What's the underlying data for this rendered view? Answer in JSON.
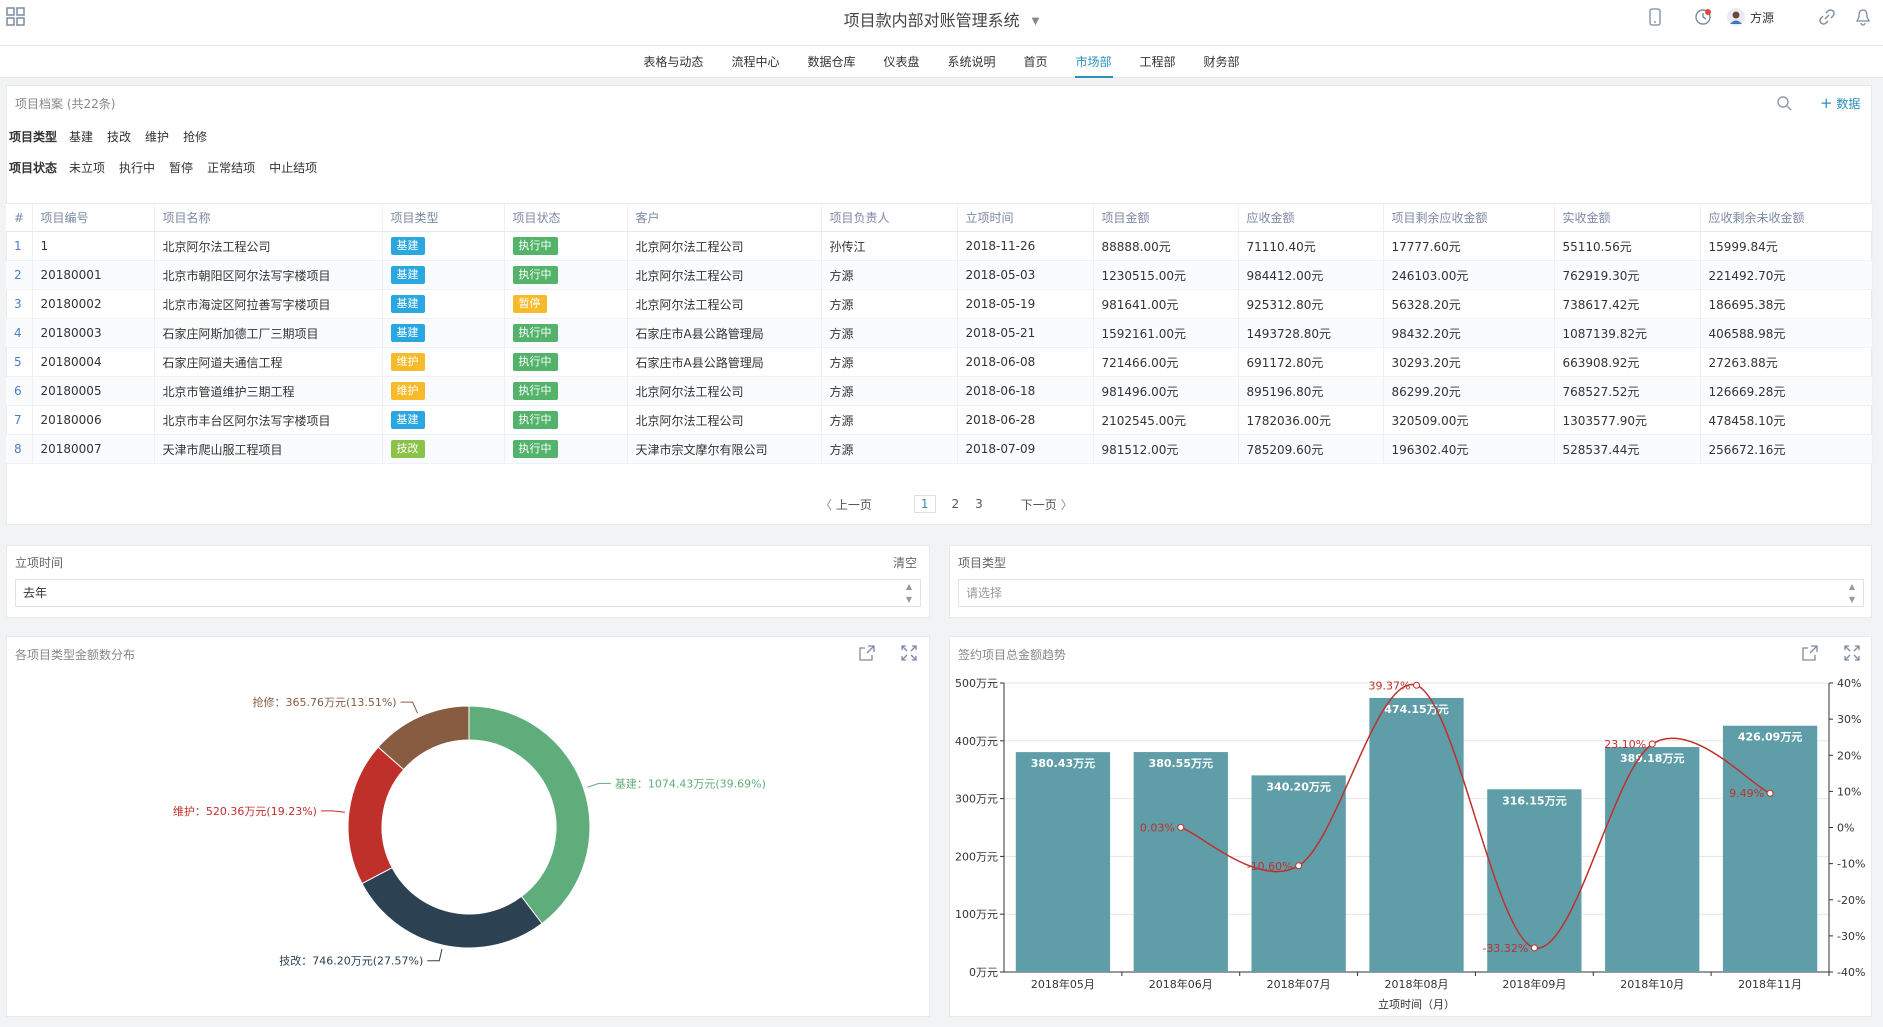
{
  "header": {
    "title": "项目款内部对账管理系统",
    "user_name": "方源"
  },
  "nav": {
    "tabs": [
      "表格与动态",
      "流程中心",
      "数据仓库",
      "仪表盘",
      "系统说明",
      "首页",
      "市场部",
      "工程部",
      "财务部"
    ],
    "active_index": 6
  },
  "archive": {
    "title": "项目档案 (共22条)",
    "add_label": "数据",
    "filters": [
      {
        "label": "项目类型",
        "options": [
          "基建",
          "技改",
          "维护",
          "抢修"
        ]
      },
      {
        "label": "项目状态",
        "options": [
          "未立项",
          "执行中",
          "暂停",
          "正常结项",
          "中止结项"
        ]
      }
    ],
    "columns": [
      "#",
      "项目编号",
      "项目名称",
      "项目类型",
      "项目状态",
      "客户",
      "项目负责人",
      "立项时间",
      "项目金额",
      "应收金额",
      "项目剩余应收金额",
      "实收金额",
      "应收剩余未收金额"
    ],
    "rows": [
      [
        "1",
        "1",
        "北京阿尔法工程公司",
        "基建",
        "执行中",
        "北京阿尔法工程公司",
        "孙传江",
        "2018-11-26",
        "88888.00元",
        "71110.40元",
        "17777.60元",
        "55110.56元",
        "15999.84元"
      ],
      [
        "2",
        "20180001",
        "北京市朝阳区阿尔法写字楼项目",
        "基建",
        "执行中",
        "北京阿尔法工程公司",
        "方源",
        "2018-05-03",
        "1230515.00元",
        "984412.00元",
        "246103.00元",
        "762919.30元",
        "221492.70元"
      ],
      [
        "3",
        "20180002",
        "北京市海淀区阿拉善写字楼项目",
        "基建",
        "暂停",
        "北京阿尔法工程公司",
        "方源",
        "2018-05-19",
        "981641.00元",
        "925312.80元",
        "56328.20元",
        "738617.42元",
        "186695.38元"
      ],
      [
        "4",
        "20180003",
        "石家庄阿斯加德工厂三期项目",
        "基建",
        "执行中",
        "石家庄市A县公路管理局",
        "方源",
        "2018-05-21",
        "1592161.00元",
        "1493728.80元",
        "98432.20元",
        "1087139.82元",
        "406588.98元"
      ],
      [
        "5",
        "20180004",
        "石家庄阿道夫通信工程",
        "维护",
        "执行中",
        "石家庄市A县公路管理局",
        "方源",
        "2018-06-08",
        "721466.00元",
        "691172.80元",
        "30293.20元",
        "663908.92元",
        "27263.88元"
      ],
      [
        "6",
        "20180005",
        "北京市管道维护三期工程",
        "维护",
        "执行中",
        "北京阿尔法工程公司",
        "方源",
        "2018-06-18",
        "981496.00元",
        "895196.80元",
        "86299.20元",
        "768527.52元",
        "126669.28元"
      ],
      [
        "7",
        "20180006",
        "北京市丰台区阿尔法写字楼项目",
        "基建",
        "执行中",
        "北京阿尔法工程公司",
        "方源",
        "2018-06-28",
        "2102545.00元",
        "1782036.00元",
        "320509.00元",
        "1303577.90元",
        "478458.10元"
      ],
      [
        "8",
        "20180007",
        "天津市爬山服工程项目",
        "技改",
        "执行中",
        "天津市宗文摩尔有限公司",
        "方源",
        "2018-07-09",
        "981512.00元",
        "785209.60元",
        "196302.40元",
        "528537.44元",
        "256672.16元"
      ]
    ],
    "pager": {
      "prev": "上一页",
      "pages": [
        "1",
        "2",
        "3"
      ],
      "current": "1",
      "next": "下一页"
    }
  },
  "filters2": {
    "date_label": "立项时间",
    "clear_label": "清空",
    "date_value": "去年",
    "type_label": "项目类型",
    "type_placeholder": "请选择"
  },
  "colors": {
    "基建": "#5fad7a",
    "技改": "#2c4152",
    "维护": "#c0302a",
    "抢修": "#875c40",
    "bar": "#5f9ea8",
    "line": "#c0302a"
  },
  "chart_data": [
    {
      "type": "pie",
      "title": "各项目类型金额数分布",
      "slices": [
        {
          "name": "基建",
          "value": 1074.43,
          "label": "基建：1074.43万元(39.69%)"
        },
        {
          "name": "技改",
          "value": 746.2,
          "label": "技改：746.20万元(27.57%)"
        },
        {
          "name": "维护",
          "value": 520.36,
          "label": "维护：520.36万元(19.23%)"
        },
        {
          "name": "抢修",
          "value": 365.76,
          "label": "抢修：365.76万元(13.51%)"
        }
      ]
    },
    {
      "type": "bar",
      "title": "签约项目总金额趋势",
      "xlabel": "立项时间（月）",
      "categories": [
        "2018年05月",
        "2018年06月",
        "2018年07月",
        "2018年08月",
        "2018年09月",
        "2018年10月",
        "2018年11月"
      ],
      "values": [
        380.43,
        380.55,
        340.2,
        474.15,
        316.15,
        389.18,
        426.09
      ],
      "value_labels": [
        "380.43万元",
        "380.55万元",
        "340.20万元",
        "474.15万元",
        "316.15万元",
        "389.18万元",
        "426.09万元"
      ],
      "ylim": [
        0,
        500
      ],
      "yticks": [
        "0万元",
        "100万元",
        "200万元",
        "300万元",
        "400万元",
        "500万元"
      ],
      "line": {
        "values": [
          0.03,
          -10.6,
          39.37,
          -33.32,
          23.1,
          9.49
        ],
        "start_index": 1,
        "labels": [
          "0.03%",
          "-10.60%",
          "39.37%",
          "-33.32%",
          "23.10%",
          "9.49%"
        ],
        "y2lim": [
          -40,
          40
        ],
        "y2ticks": [
          "-40%",
          "-30%",
          "-20%",
          "-10%",
          "0%",
          "10%",
          "20%",
          "30%",
          "40%"
        ]
      }
    }
  ]
}
